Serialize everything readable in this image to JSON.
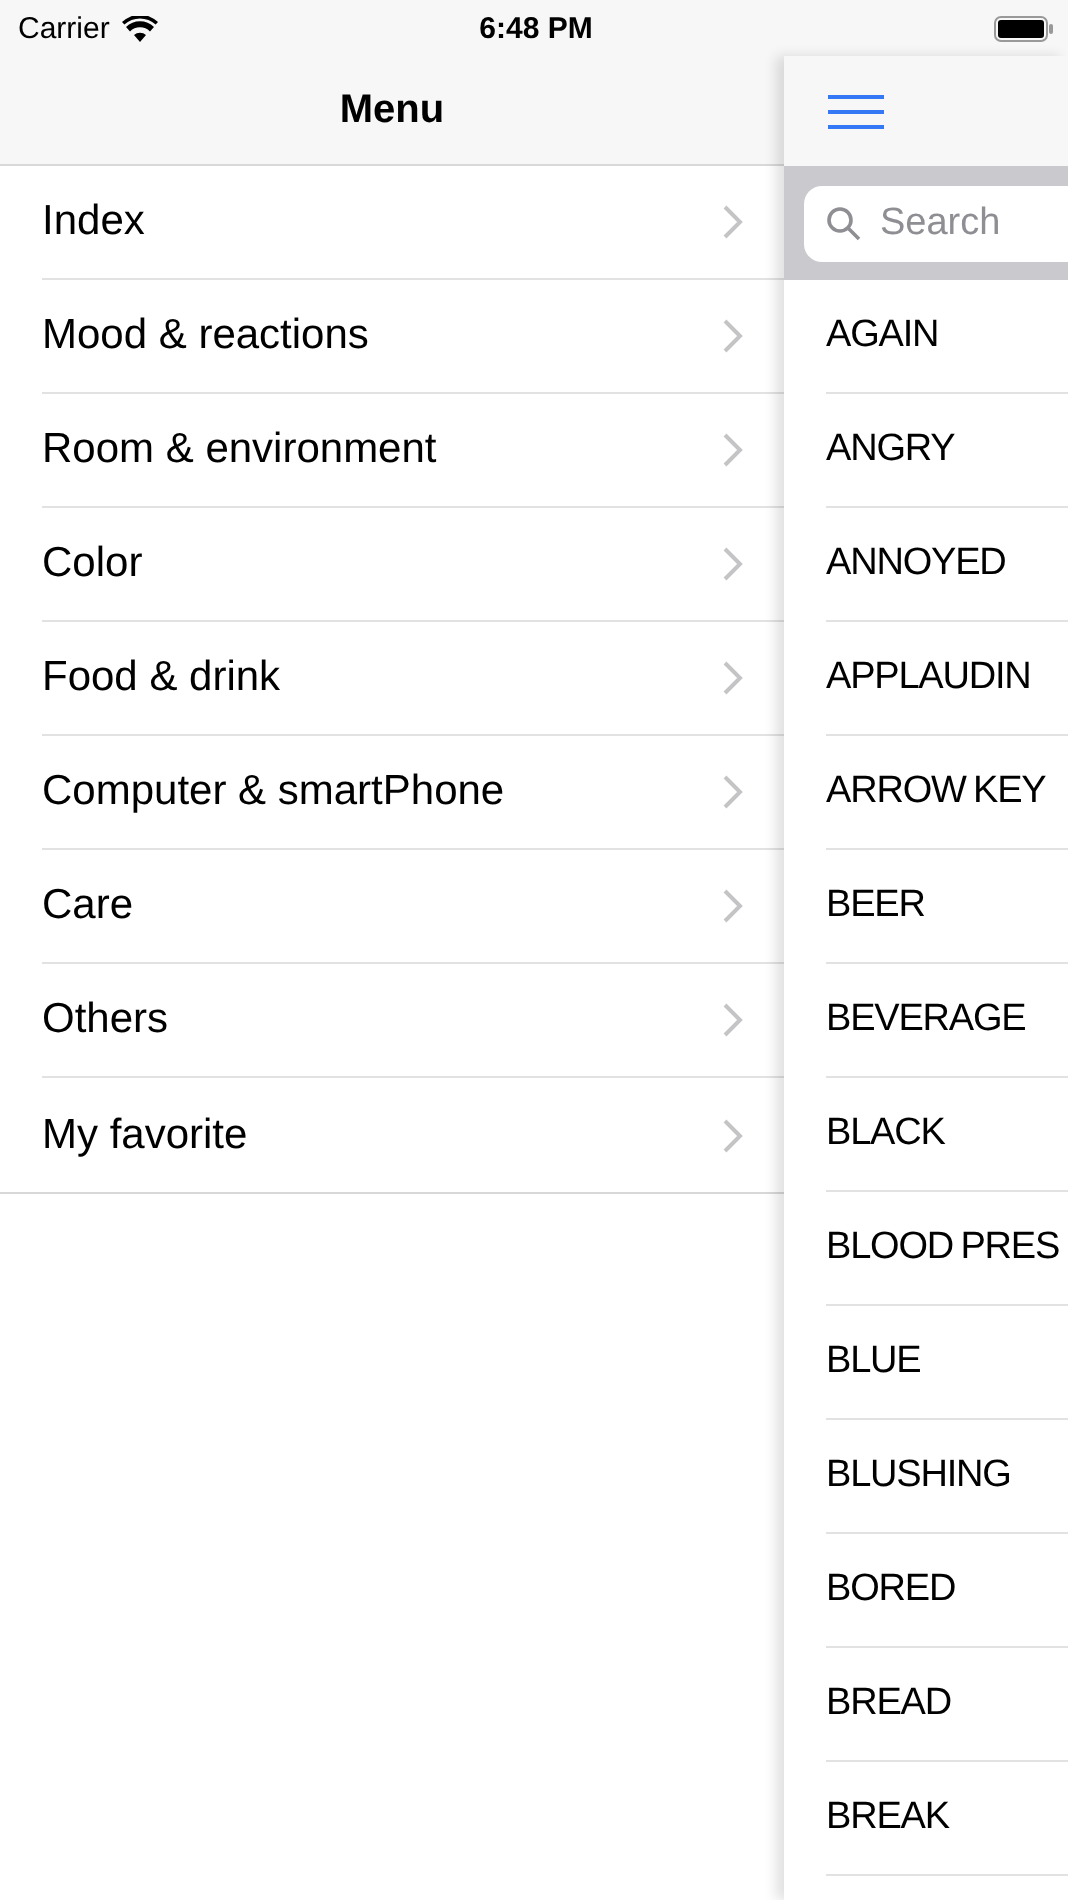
{
  "status_bar": {
    "carrier": "Carrier",
    "time": "6:48 PM"
  },
  "menu": {
    "title": "Menu",
    "items": [
      {
        "label": "Index"
      },
      {
        "label": "Mood & reactions"
      },
      {
        "label": "Room & environment"
      },
      {
        "label": "Color"
      },
      {
        "label": "Food & drink"
      },
      {
        "label": "Computer & smartPhone"
      },
      {
        "label": "Care"
      },
      {
        "label": "Others"
      },
      {
        "label": "My favorite"
      }
    ]
  },
  "index_panel": {
    "search": {
      "placeholder": "Search"
    },
    "words": [
      "AGAIN",
      "ANGRY",
      "ANNOYED",
      "APPLAUDIN",
      "ARROW KEY",
      "BEER",
      "BEVERAGE",
      "BLACK",
      "BLOOD PRES",
      "BLUE",
      "BLUSHING",
      "BORED",
      "BREAD",
      "BREAK"
    ]
  }
}
